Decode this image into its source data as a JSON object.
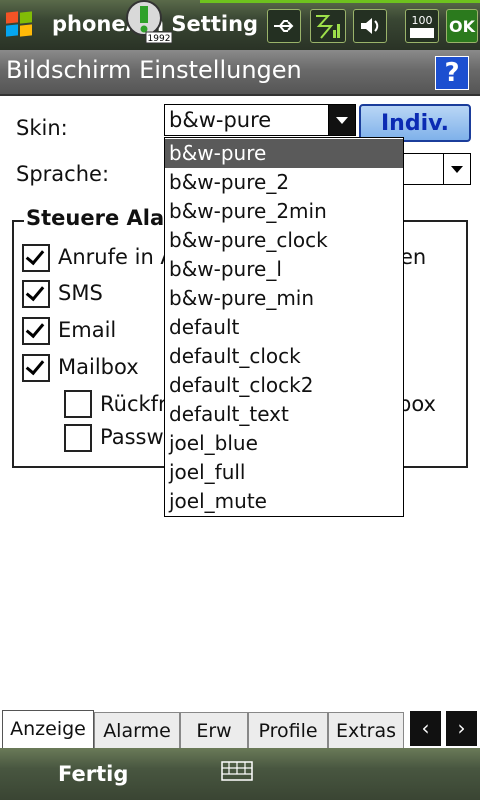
{
  "status_bar": {
    "app_title": "phoneA  n Setting",
    "icons": [
      "windows-start-icon",
      "notification-icon",
      "usb-icon",
      "signal-icon",
      "volume-icon",
      "battery-icon",
      "ok-button"
    ],
    "ok_label": "OK",
    "battery_label": "100",
    "notification_label": "1992"
  },
  "title_bar": {
    "title": "Bildschirm Einstellungen",
    "help_label": "?"
  },
  "form": {
    "skin_label": "Skin:",
    "skin_value": "b&w-pure",
    "indiv_button": "Indiv.",
    "language_label": "Sprache:",
    "language_value": ""
  },
  "group": {
    "title": "Steuere Ala",
    "items": [
      {
        "label": "Anrufe in A",
        "tail": "en",
        "checked": true
      },
      {
        "label": "SMS",
        "checked": true
      },
      {
        "label": "Email",
        "checked": true
      },
      {
        "label": "Mailbox",
        "checked": true
      }
    ],
    "sub_items": [
      {
        "label": "Rückfr",
        "tail": "box",
        "checked": false
      },
      {
        "label": "Passw",
        "checked": false
      }
    ]
  },
  "dropdown": {
    "selected_index": 0,
    "options": [
      "b&w-pure",
      "b&w-pure_2",
      "b&w-pure_2min",
      "b&w-pure_clock",
      "b&w-pure_l",
      "b&w-pure_min",
      "default",
      "default_clock",
      "default_clock2",
      "default_text",
      "joel_blue",
      "joel_full",
      "joel_mute"
    ]
  },
  "tabs": [
    "Anzeige",
    "Alarme",
    "Erw",
    "Profile",
    "Extras"
  ],
  "tab_nav": {
    "prev": "‹",
    "next": "›"
  },
  "bottom_bar": {
    "left_softkey": "Fertig"
  },
  "colors": {
    "accent": "#1c4fd0",
    "status_green": "#6ec21e",
    "selection": "#5a5a5a"
  }
}
